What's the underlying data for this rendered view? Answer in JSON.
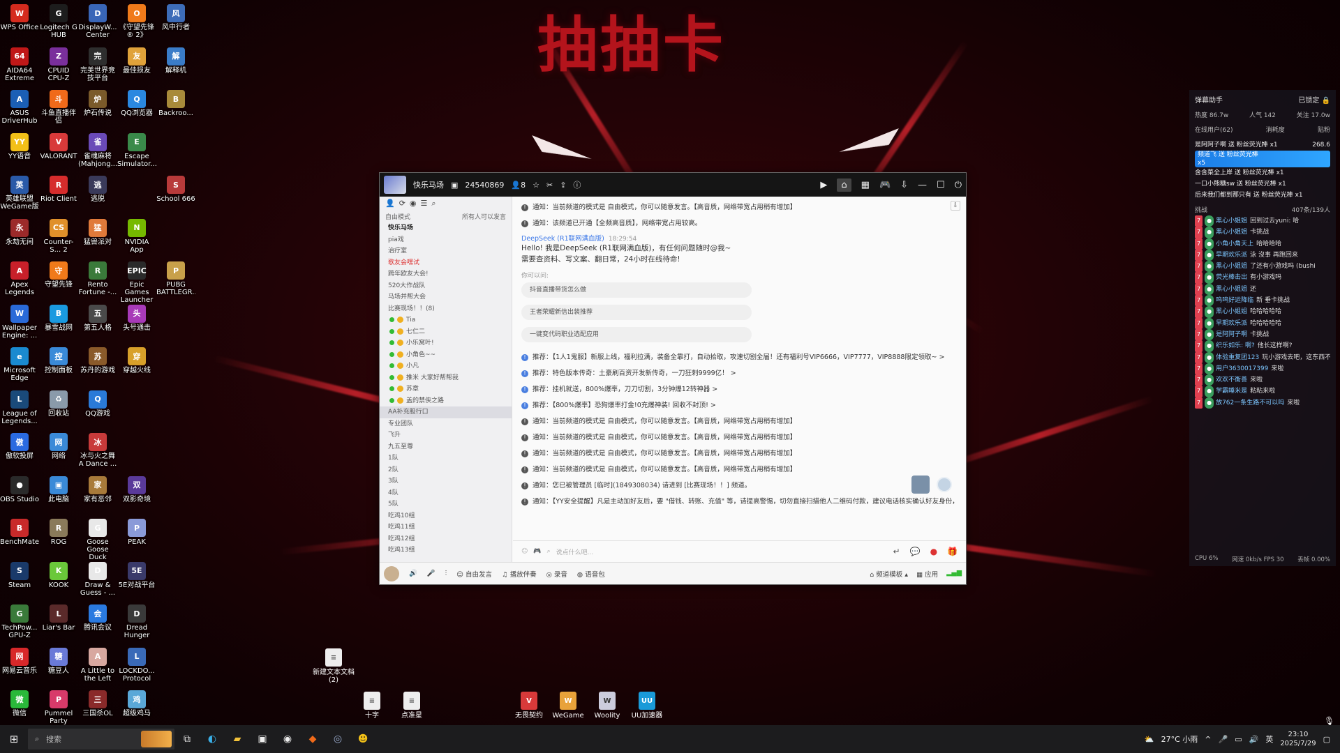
{
  "wallpaper": {
    "banner_text": "抽抽卡"
  },
  "desktop_icons": [
    {
      "label": "WPS Office",
      "icon": "wps-icon",
      "color": "#d52b1e",
      "g": "W"
    },
    {
      "label": "Logitech G HUB",
      "icon": "logitech-icon",
      "color": "#1d1d1d",
      "g": "G"
    },
    {
      "label": "DisplayW... Center",
      "icon": "display-icon",
      "color": "#3966b8",
      "g": "D"
    },
    {
      "label": "《守望先锋® 2》",
      "icon": "overwatch-icon",
      "color": "#f07a1a",
      "g": "O"
    },
    {
      "label": "风中行者",
      "icon": "wind-icon",
      "color": "#3d6cb8",
      "g": "风"
    },
    {
      "label": "AIDA64 Extreme",
      "icon": "aida-icon",
      "color": "#c01818",
      "g": "64"
    },
    {
      "label": "CPUID CPU-Z",
      "icon": "cpuz-icon",
      "color": "#7a2f9c",
      "g": "Z"
    },
    {
      "label": "完美世界竞技平台",
      "icon": "perfect-icon",
      "color": "#2e2e2e",
      "g": "完"
    },
    {
      "label": "最佳损友",
      "icon": "friend-icon",
      "color": "#e0a23a",
      "g": "友"
    },
    {
      "label": "解释机",
      "icon": "explain-icon",
      "color": "#3a7cc8",
      "g": "解"
    },
    {
      "label": "ASUS DriverHub",
      "icon": "asus-icon",
      "color": "#1b5fb5",
      "g": "A"
    },
    {
      "label": "斗鱼直播伴侣",
      "icon": "douyu-icon",
      "color": "#f06a1a",
      "g": "斗"
    },
    {
      "label": "炉石传说",
      "icon": "hearthstone-icon",
      "color": "#7a5a2a",
      "g": "炉"
    },
    {
      "label": "QQ浏览器",
      "icon": "qqbrowser-icon",
      "color": "#2a88e0",
      "g": "Q"
    },
    {
      "label": "Backroo...",
      "icon": "backrooms-icon",
      "color": "#a88a3a",
      "g": "B"
    },
    {
      "label": "YY语音",
      "icon": "yy-icon",
      "color": "#f2c018",
      "g": "YY"
    },
    {
      "label": "VALORANT",
      "icon": "valorant-icon",
      "color": "#d83a3a",
      "g": "V"
    },
    {
      "label": "雀魂麻将(Mahjong...",
      "icon": "mahjong-icon",
      "color": "#6a4ab8",
      "g": "雀"
    },
    {
      "label": "Escape Simulator...",
      "icon": "escape-icon",
      "color": "#3a8a4a",
      "g": "E"
    },
    {
      "label": "",
      "icon": "blank-icon",
      "color": "transparent",
      "g": ""
    },
    {
      "label": "英雄联盟WeGame版",
      "icon": "lol-wegame-icon",
      "color": "#2a5aa8",
      "g": "英"
    },
    {
      "label": "Riot Client",
      "icon": "riot-icon",
      "color": "#d62c2c",
      "g": "R"
    },
    {
      "label": "逃脱",
      "icon": "escape2-icon",
      "color": "#3a3a5a",
      "g": "逃"
    },
    {
      "label": "",
      "icon": "blank-icon",
      "color": "transparent",
      "g": ""
    },
    {
      "label": "School 666",
      "icon": "school-icon",
      "color": "#b83a3a",
      "g": "S"
    },
    {
      "label": "永劫无间",
      "icon": "naraka-icon",
      "color": "#9c2a2a",
      "g": "永"
    },
    {
      "label": "Counter-S... 2",
      "icon": "cs2-icon",
      "color": "#e0902a",
      "g": "CS"
    },
    {
      "label": "猛兽派对",
      "icon": "party-icon",
      "color": "#e07a3a",
      "g": "猛"
    },
    {
      "label": "NVIDIA App",
      "icon": "nvidia-icon",
      "color": "#76b900",
      "g": "N"
    },
    {
      "label": "",
      "icon": "blank-icon",
      "color": "transparent",
      "g": ""
    },
    {
      "label": "Apex Legends",
      "icon": "apex-icon",
      "color": "#c8202a",
      "g": "A"
    },
    {
      "label": "守望先锋",
      "icon": "overwatch2-icon",
      "color": "#f07a1a",
      "g": "守"
    },
    {
      "label": "Rento Fortune -...",
      "icon": "rento-icon",
      "color": "#3a7a3a",
      "g": "R"
    },
    {
      "label": "Epic Games Launcher",
      "icon": "epic-icon",
      "color": "#2a2a2a",
      "g": "EPIC"
    },
    {
      "label": "PUBG BATTLEGR...",
      "icon": "pubg-icon",
      "color": "#c8a04a",
      "g": "P"
    },
    {
      "label": "Wallpaper Engine: ...",
      "icon": "wallpaper-icon",
      "color": "#2a6ad8",
      "g": "W"
    },
    {
      "label": "暴雪战网",
      "icon": "battlenet-icon",
      "color": "#1a9ae0",
      "g": "B"
    },
    {
      "label": "第五人格",
      "icon": "identity-icon",
      "color": "#4a4a4a",
      "g": "五"
    },
    {
      "label": "头号通击",
      "icon": "hit-icon",
      "color": "#a83ab8",
      "g": "头"
    },
    {
      "label": "",
      "icon": "blank-icon",
      "color": "transparent",
      "g": ""
    },
    {
      "label": "Microsoft Edge",
      "icon": "edge-icon",
      "color": "#1a8ad0",
      "g": "e"
    },
    {
      "label": "控制面板",
      "icon": "control-panel-icon",
      "color": "#3a8ad8",
      "g": "控"
    },
    {
      "label": "苏丹的游戏",
      "icon": "sultan-icon",
      "color": "#8a5a2a",
      "g": "苏"
    },
    {
      "label": "穿越火线",
      "icon": "cf-icon",
      "color": "#d8a02a",
      "g": "穿"
    },
    {
      "label": "",
      "icon": "blank-icon",
      "color": "transparent",
      "g": ""
    },
    {
      "label": "League of Legends...",
      "icon": "lol-icon",
      "color": "#1a4a7a",
      "g": "L"
    },
    {
      "label": "回收站",
      "icon": "recycle-bin-icon",
      "color": "#8a9aaa",
      "g": "♻"
    },
    {
      "label": "QQ游戏",
      "icon": "qqgame-icon",
      "color": "#2a7ad8",
      "g": "Q"
    },
    {
      "label": "",
      "icon": "blank-icon",
      "color": "transparent",
      "g": ""
    },
    {
      "label": "",
      "icon": "blank-icon",
      "color": "transparent",
      "g": ""
    },
    {
      "label": "傲软投屏",
      "icon": "apowermirror-icon",
      "color": "#2a6ae0",
      "g": "傲"
    },
    {
      "label": "网络",
      "icon": "network-icon",
      "color": "#3a8ad8",
      "g": "网"
    },
    {
      "label": "冰与火之舞 A Dance ...",
      "icon": "dance-icon",
      "color": "#c83a3a",
      "g": "冰"
    },
    {
      "label": "",
      "icon": "blank-icon",
      "color": "transparent",
      "g": ""
    },
    {
      "label": "",
      "icon": "blank-icon",
      "color": "transparent",
      "g": ""
    },
    {
      "label": "OBS Studio",
      "icon": "obs-icon",
      "color": "#2a2a2a",
      "g": "●"
    },
    {
      "label": "此电脑",
      "icon": "this-pc-icon",
      "color": "#3a8ad8",
      "g": "▣"
    },
    {
      "label": "家有恶邻",
      "icon": "neighbor-icon",
      "color": "#a87a3a",
      "g": "家"
    },
    {
      "label": "双影奇境",
      "icon": "split-icon",
      "color": "#5a3a9a",
      "g": "双"
    },
    {
      "label": "",
      "icon": "blank-icon",
      "color": "transparent",
      "g": ""
    },
    {
      "label": "BenchMate",
      "icon": "benchmate-icon",
      "color": "#c82a2a",
      "g": "B"
    },
    {
      "label": "ROG",
      "icon": "rog-icon",
      "color": "#8a7a5a",
      "g": "R"
    },
    {
      "label": "Goose Goose Duck",
      "icon": "goose-icon",
      "color": "#e8e8e8",
      "g": "G"
    },
    {
      "label": "PEAK",
      "icon": "peak-icon",
      "color": "#8a9ad8",
      "g": "P"
    },
    {
      "label": "",
      "icon": "blank-icon",
      "color": "transparent",
      "g": ""
    },
    {
      "label": "Steam",
      "icon": "steam-icon",
      "color": "#1a3a6a",
      "g": "S"
    },
    {
      "label": "KOOK",
      "icon": "kook-icon",
      "color": "#6ac83a",
      "g": "K"
    },
    {
      "label": "Draw & Guess - ...",
      "icon": "draw-icon",
      "color": "#e8e8e8",
      "g": "D"
    },
    {
      "label": "5E对战平台",
      "icon": "5e-icon",
      "color": "#3a3a6a",
      "g": "5E"
    },
    {
      "label": "",
      "icon": "blank-icon",
      "color": "transparent",
      "g": ""
    },
    {
      "label": "TechPow... GPU-Z",
      "icon": "gpuz-icon",
      "color": "#3a7a3a",
      "g": "G"
    },
    {
      "label": "Liar's Bar",
      "icon": "liarsbar-icon",
      "color": "#5a2a2a",
      "g": "L"
    },
    {
      "label": "腾讯会议",
      "icon": "meeting-icon",
      "color": "#2a7ae0",
      "g": "会"
    },
    {
      "label": "Dread Hunger",
      "icon": "dread-icon",
      "color": "#3a3a3a",
      "g": "D"
    },
    {
      "label": "",
      "icon": "blank-icon",
      "color": "transparent",
      "g": ""
    },
    {
      "label": "网易云音乐",
      "icon": "netease-icon",
      "color": "#d8282a",
      "g": "网"
    },
    {
      "label": "糖豆人",
      "icon": "fallguys-icon",
      "color": "#6a7ad8",
      "g": "糖"
    },
    {
      "label": "A Little to the Left",
      "icon": "littleleft-icon",
      "color": "#d8a8a0",
      "g": "A"
    },
    {
      "label": "LOCKDO... Protocol",
      "icon": "lockdown-icon",
      "color": "#3a6ab8",
      "g": "L"
    },
    {
      "label": "",
      "icon": "blank-icon",
      "color": "transparent",
      "g": ""
    },
    {
      "label": "微信",
      "icon": "wechat-icon",
      "color": "#2ab83a",
      "g": "微"
    },
    {
      "label": "Pummel Party",
      "icon": "pummel-icon",
      "color": "#d83a6a",
      "g": "P"
    },
    {
      "label": "三国杀OL",
      "icon": "sanguosha-icon",
      "color": "#8a2a2a",
      "g": "三"
    },
    {
      "label": "超级鸡马",
      "icon": "chicken-icon",
      "color": "#5aa8d8",
      "g": "鸡"
    }
  ],
  "loose_icons": [
    {
      "label": "新建文本文档 (2)",
      "icon": "text-file-icon"
    },
    {
      "label": "十字",
      "icon": "file-icon"
    },
    {
      "label": "点准星",
      "icon": "file-icon"
    },
    {
      "label": "无畏契约",
      "icon": "valorant-icon"
    },
    {
      "label": "WeGame",
      "icon": "wegame-icon"
    },
    {
      "label": "Woolity",
      "icon": "woolity-icon"
    },
    {
      "label": "UU加速器",
      "icon": "uu-icon"
    }
  ],
  "yy_window": {
    "title": "快乐马场",
    "room_id": "24540869",
    "user_count": "8",
    "mode": "自由模式",
    "mode_right": "所有人可以发言",
    "channels": [
      {
        "label": "快乐马场",
        "type": "top"
      },
      {
        "label": "pia戏",
        "type": "row"
      },
      {
        "label": "治疗室",
        "type": "row"
      },
      {
        "label": "歌友会嘿试",
        "type": "red"
      },
      {
        "label": "跨年欧友大会!",
        "type": "row"
      },
      {
        "label": "520大作战队",
        "type": "row"
      },
      {
        "label": "马场并帮大会",
        "type": "row"
      },
      {
        "label": "比赛现场！！(8)",
        "type": "row"
      },
      {
        "label": "Tia",
        "type": "user"
      },
      {
        "label": "七仁二",
        "type": "user"
      },
      {
        "label": "小乐窝叶!",
        "type": "user"
      },
      {
        "label": "小角色~~",
        "type": "user"
      },
      {
        "label": "小凡",
        "type": "user"
      },
      {
        "label": "推米  大家好帮帮我",
        "type": "user"
      },
      {
        "label": "苏章",
        "type": "user"
      },
      {
        "label": "盖的禁侠之路",
        "type": "user"
      },
      {
        "label": "AA补充股行口",
        "type": "sel"
      },
      {
        "label": "专业团队",
        "type": "row"
      },
      {
        "label": "飞升",
        "type": "row"
      },
      {
        "label": "九五至尊",
        "type": "row"
      },
      {
        "label": "1队",
        "type": "row"
      },
      {
        "label": "2队",
        "type": "row"
      },
      {
        "label": "3队",
        "type": "row"
      },
      {
        "label": "4队",
        "type": "row"
      },
      {
        "label": "5队",
        "type": "row"
      },
      {
        "label": "吃鸡10组",
        "type": "row"
      },
      {
        "label": "吃鸡11组",
        "type": "row"
      },
      {
        "label": "吃鸡12组",
        "type": "row"
      },
      {
        "label": "吃鸡13组",
        "type": "row"
      }
    ],
    "notices_top": [
      "通知：当前频道的模式是 自由模式，你可以随意发言。【高音质，网络带宽占用稍有增加】",
      "通知：该频道已开通【全频高音质】，网络带宽占用较高。"
    ],
    "deepseek": {
      "name": "DeepSeek (R1联网满血版)",
      "time": "18:29:54",
      "line1": "Hello! 我是DeepSeek (R1联网满血版)，有任何问题随时@我~",
      "line2": "需要查资料、写文案、翻日常，24小时在线待命!"
    },
    "suggest_label": "你可以问:",
    "suggestions": [
      "抖音直播带货怎么做",
      "王者荣耀新信出装推荐",
      "一键变代码职业选配应用"
    ],
    "rec_msgs": [
      "推荐：【1人1鬼服】新服上线，福利拉满，装备全靠打，自动拾取，攻速切割全届！还有福利号VIP6666，VIP7777，VIP8888限定领取~ >",
      "推荐：特色版本传奇：土豪刷百资开发新传奇，一刀狂刺9999亿！ >",
      "推荐：挂机就送，800%爆率，刀刀切割，3分钟爆12转神器 >",
      "推荐：【800%爆率】恐狗爆率打金!0充爆神装! 回收不封顶! >"
    ],
    "notices_bottom": [
      "通知：当前频道的模式是 自由模式，你可以随意发言。【高音质，网络带宽占用稍有增加】",
      "通知：当前频道的模式是 自由模式，你可以随意发言。【高音质，网络带宽占用稍有增加】",
      "通知：当前频道的模式是 自由模式，你可以随意发言。【高音质，网络带宽占用稍有增加】",
      "通知：当前频道的模式是 自由模式，你可以随意发言。【高音质，网络带宽占用稍有增加】",
      "通知：您已被管理员 [临时](1849308034) 请进到 [比赛现场！！] 频道。",
      "通知：【YY安全提醒】凡是主动加好友后，要 \"借钱、转账、充值\" 等，请提高警惕，切勿直接扫描他人二维码付款，建议电话核实确认好友身份，遇恐怖人官方好友办理!"
    ],
    "input_placeholder": "说点什么吧...",
    "bottom_bar": {
      "free_talk": "自由发言",
      "song": "播放伴奏",
      "record": "录音",
      "voice_pack": "语音包",
      "room_template": "频道模板",
      "apps": "应用"
    }
  },
  "danmaku": {
    "title": "弹幕助手",
    "lock_label": "已锁定",
    "stats": {
      "heat": "热度 86.7w",
      "popularity": "人气 142",
      "follow": "关注 17.0w"
    },
    "tabs": {
      "online": "在线用户(62)",
      "consume": "消耗度",
      "rank": "贴粉"
    },
    "donations": [
      {
        "text": "是阿阿子啊 送 粉丝荧光棒",
        "count": "x1",
        "extra": "268.6"
      },
      {
        "text": "频道飞 送 粉丝荧光棒",
        "count": "x5"
      },
      {
        "text": "含含菜全上岸 送 粉丝荧光棒",
        "count": "x1"
      },
      {
        "text": "一口小熊糖sw 送 粉丝荧光棒",
        "count": "x1"
      },
      {
        "text": "后来我们都到那只有 送 粉丝荧光棒",
        "count": "x1"
      }
    ],
    "chat_header": "挑战",
    "chat_count": "407条/139人",
    "comments": [
      {
        "user": "黑心小姐姐",
        "text": "回到过去yuni: 哈"
      },
      {
        "user": "黑心小姐姐",
        "text": "卡挑战"
      },
      {
        "user": "小角小角天上",
        "text": "哈哈哈哈"
      },
      {
        "user": "早期欢乐派",
        "text": "泳 沒事 再跑回来"
      },
      {
        "user": "黑心小姐姐",
        "text": "了还有小游戏吗 (bushi"
      },
      {
        "user": "荧光棒击出",
        "text": "有小游戏吗"
      },
      {
        "user": "黑心小姐姐",
        "text": "还"
      },
      {
        "user": "呜呜好运降临",
        "text": "新 垂卡挑战"
      },
      {
        "user": "黑心小姐姐",
        "text": "哈哈哈哈哈"
      },
      {
        "user": "早期欢乐派",
        "text": "哈哈哈哈哈"
      },
      {
        "user": "是阿阿子啊",
        "text": "卡挑战"
      },
      {
        "user": "织乐如乐: 啊?",
        "text": "他长这样啊?"
      },
      {
        "user": "体验重复团123",
        "text": "玩小游戏去吧，这东西不看也罢"
      },
      {
        "user": "用户3630017399",
        "text": "来啦"
      },
      {
        "user": "欢欢不衡善",
        "text": "来啦"
      },
      {
        "user": "学霸睡米是",
        "text": "粘粘来啦"
      },
      {
        "user": "放762一条生路不可以吗",
        "text": "来啦"
      }
    ],
    "footer": {
      "cpu": "CPU 6%",
      "net": "网速 0kb/s FPS 30",
      "loss": "丢帧 0.00%"
    }
  },
  "taskbar": {
    "search_placeholder": "搜索",
    "weather": "27°C 小雨",
    "ime": "英",
    "time": "23:10",
    "date": "2025/7/29"
  }
}
